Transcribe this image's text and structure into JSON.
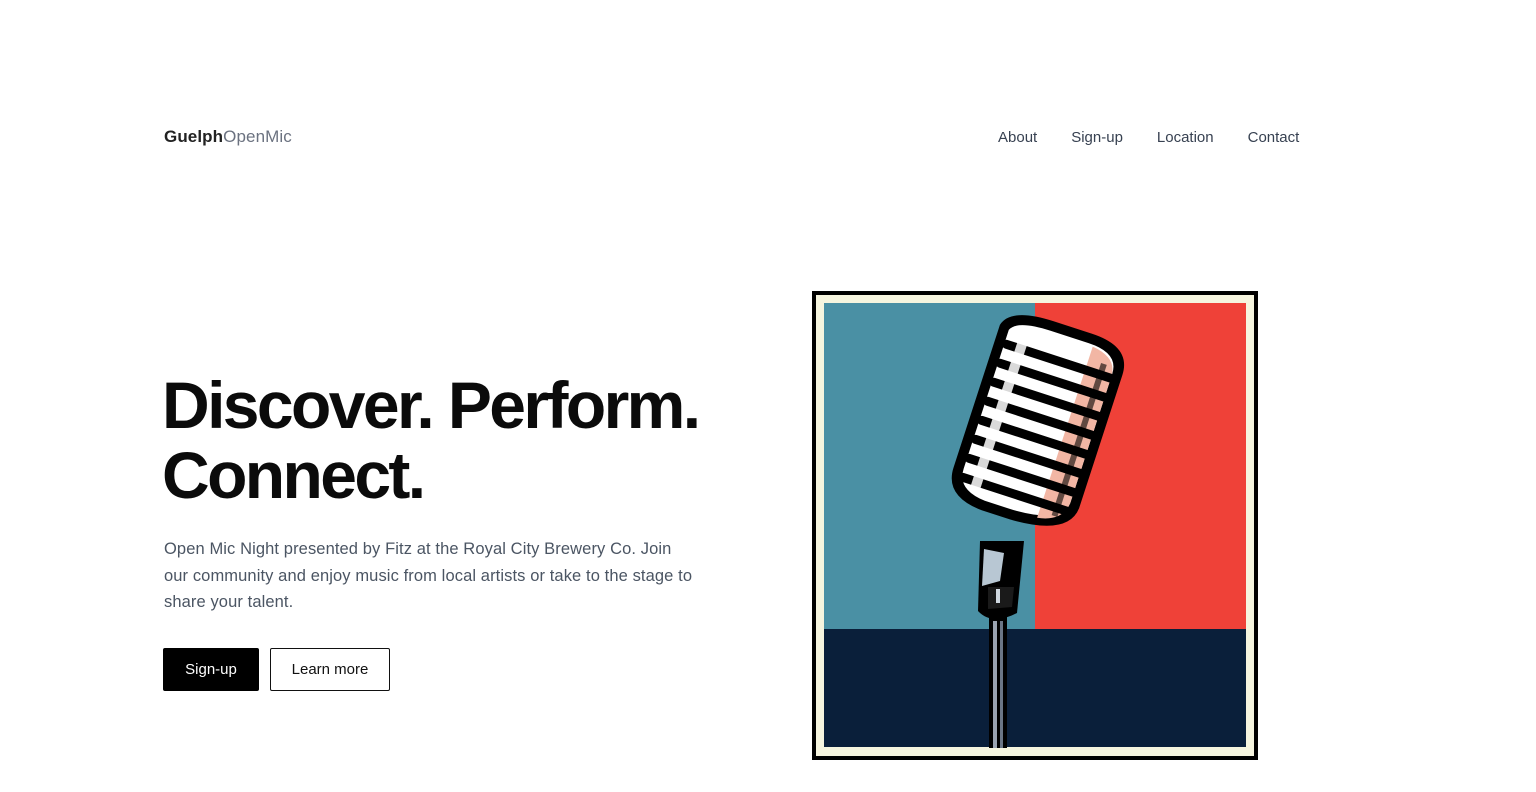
{
  "brand": {
    "bold": "Guelph",
    "light": "OpenMic"
  },
  "nav": {
    "items": [
      {
        "label": "About"
      },
      {
        "label": "Sign-up"
      },
      {
        "label": "Location"
      },
      {
        "label": "Contact"
      }
    ]
  },
  "hero": {
    "headline_line1": "Discover. Perform.",
    "headline_line2": "Connect.",
    "description": "Open Mic Night presented by Fitz at the Royal City Brewery Co. Join our community and enjoy music from local artists or take to the stage to share your talent.",
    "primary_button": "Sign-up",
    "secondary_button": "Learn more"
  },
  "poster": {
    "icon": "microphone-icon",
    "colors": {
      "frame": "#000000",
      "border": "#f6f5df",
      "left_panel": "#4a90a4",
      "right_panel": "#ef4138",
      "floor": "#0a1f3a"
    }
  }
}
